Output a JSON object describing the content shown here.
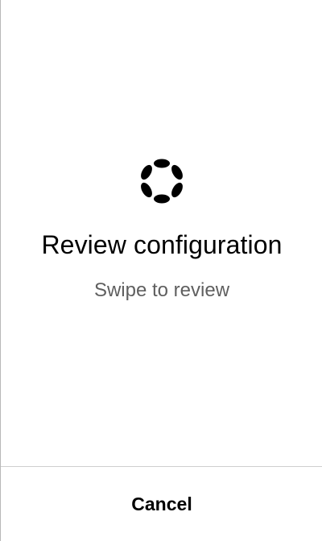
{
  "logo": {
    "icon": "polkadot-logo-icon",
    "color": "#000000"
  },
  "title": "Review configuration",
  "subtitle": "Swipe to review",
  "footer": {
    "cancel_label": "Cancel"
  }
}
